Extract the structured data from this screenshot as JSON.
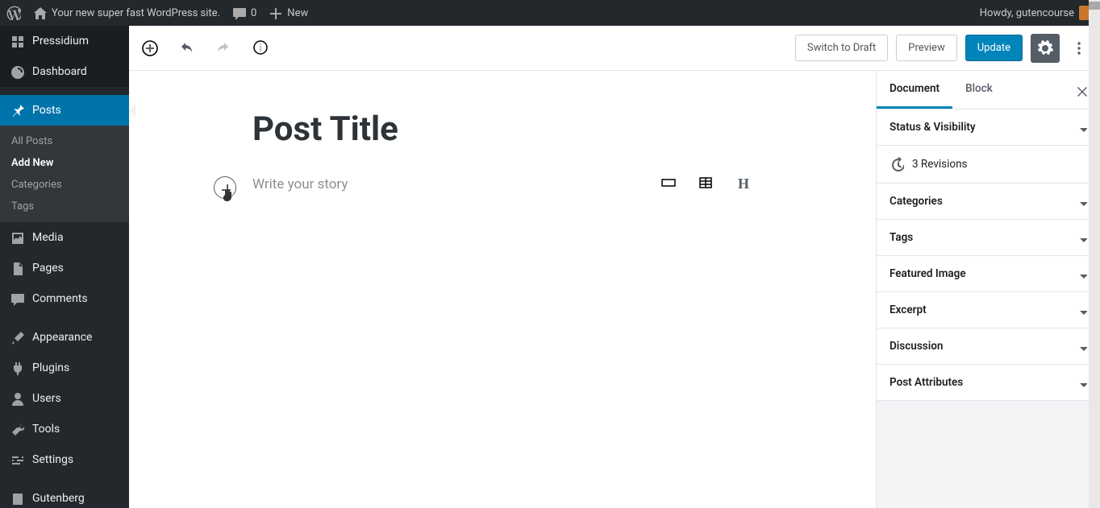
{
  "adminbar": {
    "site_name": "Your new super fast WordPress site.",
    "comments_count": "0",
    "new_label": "New",
    "greeting": "Howdy, gutencourse"
  },
  "sidebar": {
    "pressidium": "Pressidium",
    "dashboard": "Dashboard",
    "posts": "Posts",
    "posts_sub": {
      "all": "All Posts",
      "add": "Add New",
      "categories": "Categories",
      "tags": "Tags"
    },
    "media": "Media",
    "pages": "Pages",
    "comments": "Comments",
    "appearance": "Appearance",
    "plugins": "Plugins",
    "users": "Users",
    "tools": "Tools",
    "settings": "Settings",
    "gutenberg": "Gutenberg"
  },
  "toolbar": {
    "switch_draft": "Switch to Draft",
    "preview": "Preview",
    "update": "Update"
  },
  "editor": {
    "title": "Post Title",
    "placeholder": "Write your story"
  },
  "rightpanel": {
    "tabs": {
      "document": "Document",
      "block": "Block"
    },
    "revisions_label": "3 Revisions",
    "sections": {
      "status": "Status & Visibility",
      "categories": "Categories",
      "tags": "Tags",
      "featured": "Featured Image",
      "excerpt": "Excerpt",
      "discussion": "Discussion",
      "attributes": "Post Attributes"
    }
  }
}
